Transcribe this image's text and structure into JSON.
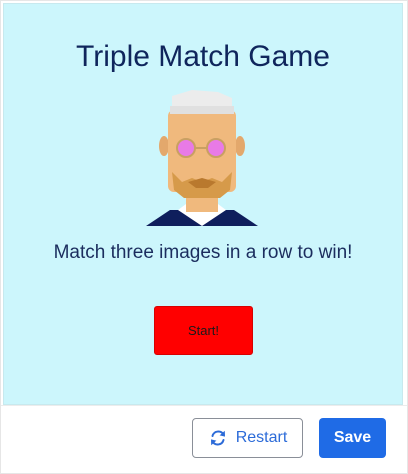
{
  "game": {
    "title": "Triple Match Game",
    "subtitle": "Match three images in a row to win!",
    "start_label": "Start!",
    "character_icon": "old-man-with-glasses-avatar"
  },
  "footer": {
    "restart_label": "Restart",
    "restart_icon": "refresh-icon",
    "save_label": "Save"
  },
  "colors": {
    "game_background": "#ccf6fc",
    "title_text": "#0f255c",
    "start_button": "#ff0000",
    "restart_text": "#2c6bd8",
    "save_button": "#1f6be6"
  }
}
